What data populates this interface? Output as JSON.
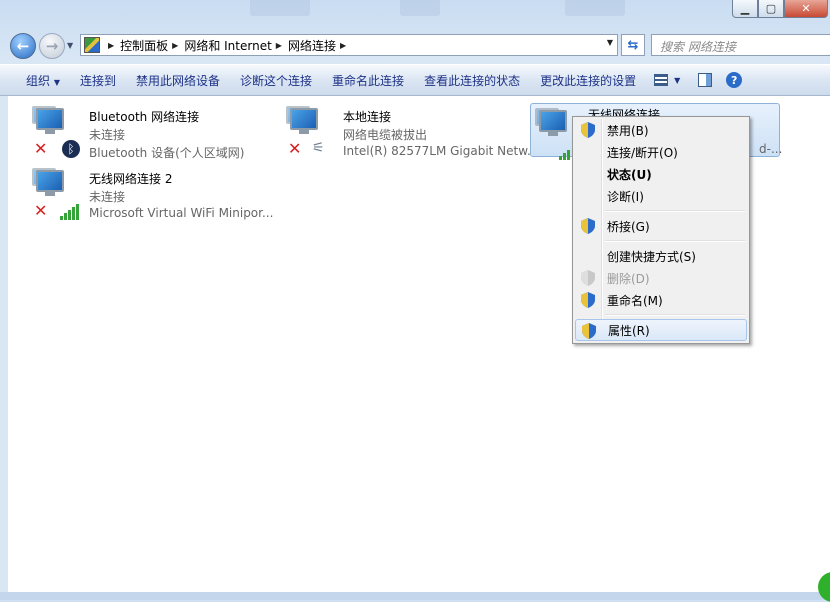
{
  "address": {
    "crumbs": [
      "控制面板",
      "网络和 Internet",
      "网络连接"
    ],
    "search_placeholder": "搜索 网络连接"
  },
  "toolbar": {
    "organize": "组织",
    "connect_to": "连接到",
    "disable_device": "禁用此网络设备",
    "diagnose": "诊断这个连接",
    "rename": "重命名此连接",
    "view_status": "查看此连接的状态",
    "change_settings": "更改此连接的设置"
  },
  "connections": [
    {
      "name": "Bluetooth 网络连接",
      "status": "未连接",
      "device": "Bluetooth 设备(个人区域网)",
      "badge": "bluetooth-icon"
    },
    {
      "name": "本地连接",
      "status": "网络电缆被拔出",
      "device": "Intel(R) 82577LM Gigabit Netw...",
      "badge": "ethernet-cable-icon"
    },
    {
      "name": "无线网络连接",
      "status": "",
      "device": "d-...",
      "badge": "signal-bars-icon"
    },
    {
      "name": "无线网络连接 2",
      "status": "未连接",
      "device": "Microsoft Virtual WiFi Minipor...",
      "badge": "signal-bars-icon"
    }
  ],
  "context_menu": {
    "disable": "禁用(B)",
    "connect_disconnect": "连接/断开(O)",
    "status": "状态(U)",
    "diagnose": "诊断(I)",
    "bridge": "桥接(G)",
    "create_shortcut": "创建快捷方式(S)",
    "delete": "删除(D)",
    "rename": "重命名(M)",
    "properties": "属性(R)"
  },
  "colors": {
    "toolbar_text": "#1e3287",
    "error_x": "#d81f1f",
    "signal_green": "#36a33a",
    "selection_border": "#8fb2d8"
  }
}
